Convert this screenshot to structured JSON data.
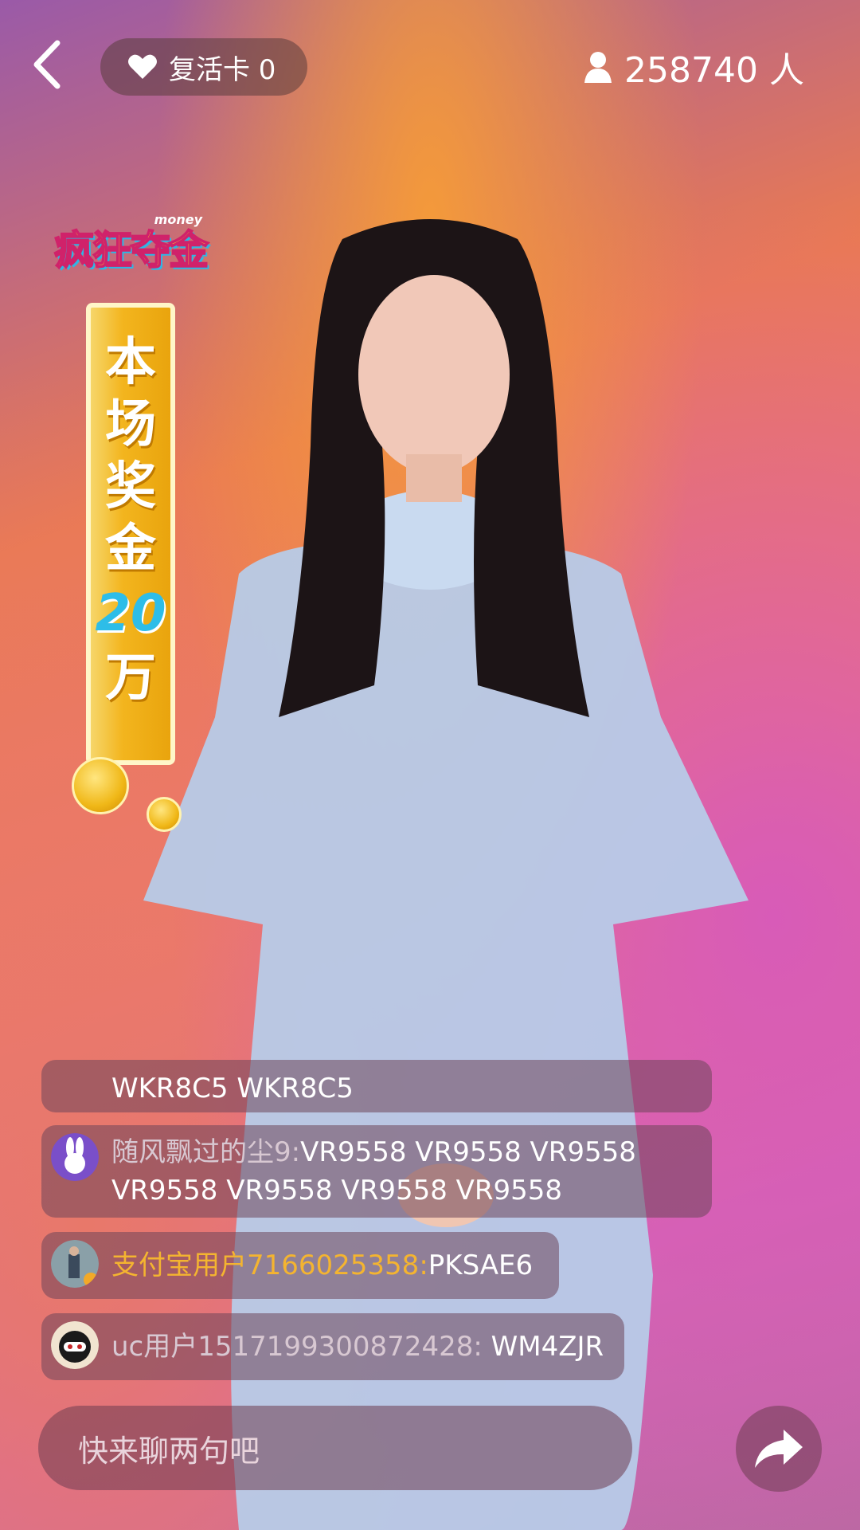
{
  "header": {
    "revive_card_label": "复活卡 0",
    "viewer_count": "258740 人"
  },
  "banner": {
    "logo_text": "疯狂夺金",
    "logo_sub": "money",
    "ribbon_chars": [
      "本",
      "场",
      "奖",
      "金"
    ],
    "amount": "20",
    "unit": "万"
  },
  "chat": {
    "messages": [
      {
        "name": "",
        "text": "WKR8C5 WKR8C5"
      },
      {
        "name": "随风飘过的尘9:",
        "text": "VR9558 VR9558 VR9558 VR9558 VR9558 VR9558 VR9558"
      },
      {
        "name": "支付宝用户7166025358:",
        "text": "PKSAE6"
      },
      {
        "name": "uc用户1517199300872428:",
        "text": " WM4ZJR"
      }
    ]
  },
  "input": {
    "placeholder": "快来聊两句吧"
  },
  "colors": {
    "highlight_name": "#f4b430",
    "overlay": "rgba(110,60,80,0.55)"
  }
}
